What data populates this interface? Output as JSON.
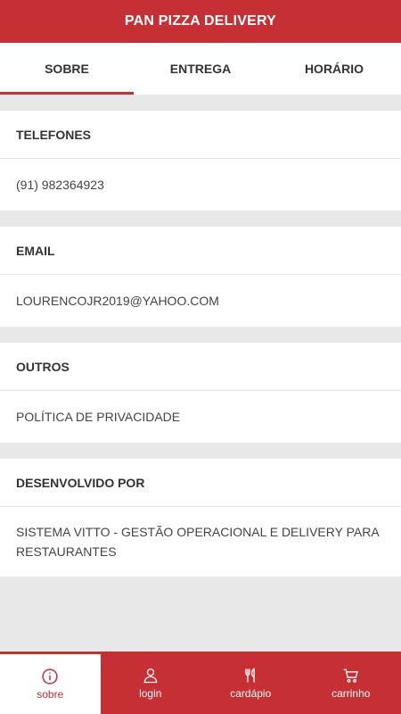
{
  "header": {
    "title": "PAN PIZZA DELIVERY"
  },
  "tabs": [
    {
      "label": "SOBRE"
    },
    {
      "label": "ENTREGA"
    },
    {
      "label": "HORÁRIO"
    }
  ],
  "sections": [
    {
      "title": "TELEFONES",
      "value": "(91) 982364923"
    },
    {
      "title": "EMAIL",
      "value": "LOURENCOJR2019@YAHOO.COM"
    },
    {
      "title": "OUTROS",
      "value": "POLÍTICA DE PRIVACIDADE"
    },
    {
      "title": "DESENVOLVIDO POR",
      "value": "SISTEMA VITTO - GESTÃO OPERACIONAL E DELIVERY PARA RESTAURANTES"
    }
  ],
  "bottom_nav": [
    {
      "label": "sobre",
      "icon": "info-icon"
    },
    {
      "label": "login",
      "icon": "user-icon"
    },
    {
      "label": "cardápio",
      "icon": "fork-knife-icon"
    },
    {
      "label": "carrinho",
      "icon": "cart-icon"
    }
  ],
  "colors": {
    "accent": "#c62f33",
    "background": "#e8e8e8"
  }
}
